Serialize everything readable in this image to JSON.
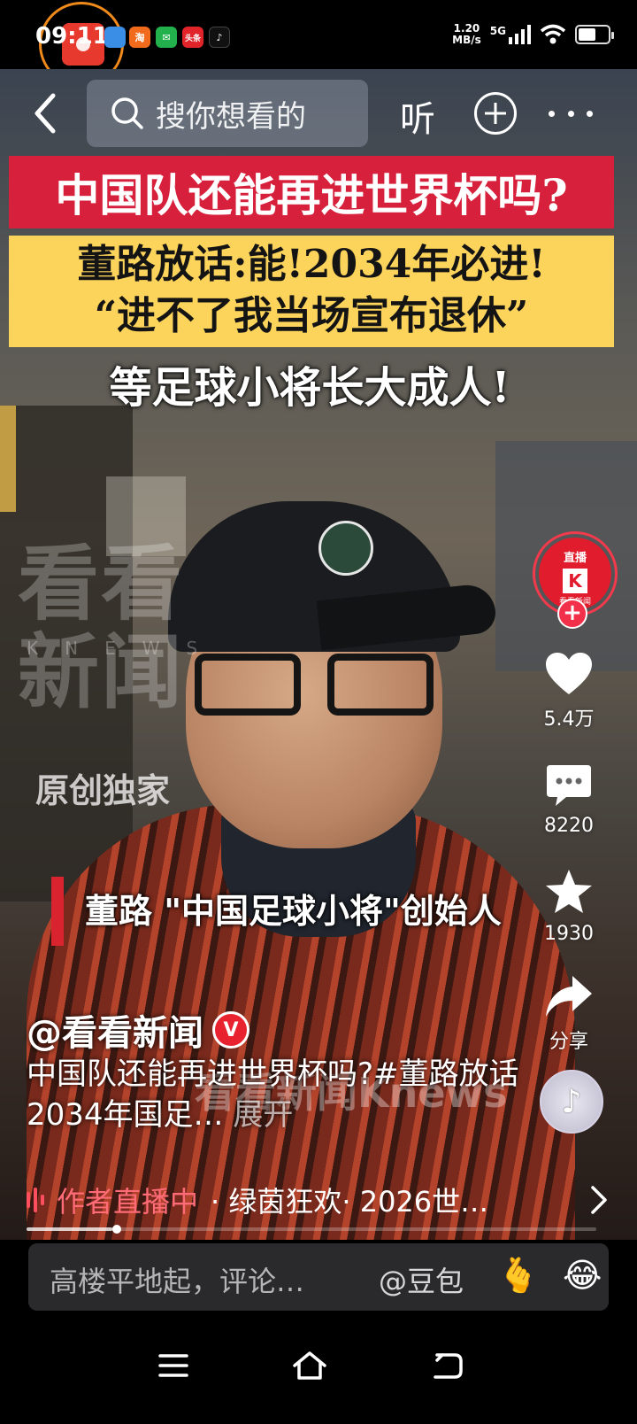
{
  "status_bar": {
    "time": "09:11",
    "net_speed_value": "1.20",
    "net_speed_unit": "MB/s",
    "network_type": "5G",
    "battery_level": 0.6
  },
  "top_nav": {
    "search_placeholder": "搜你想看的",
    "listen_label": "听"
  },
  "video": {
    "headline_red": "中国队还能再进世界杯吗?",
    "headline_yellow_line1": "董路放话:能!2034年必进!",
    "headline_yellow_line2": "“进不了我当场宣布退休”",
    "headline_white": "等足球小将长大成人!",
    "watermark_logo": "看看新闻",
    "watermark_knews": "KNEWS",
    "watermark_original": "原创独家",
    "watermark_center": "看看新闻Knews",
    "caption": "董路 \"中国足球小将\"创始人"
  },
  "side_actions": {
    "live_tag": "直播",
    "live_account": "看看新闻",
    "likes": "5.4万",
    "comments": "8220",
    "favorites": "1930",
    "share_label": "分享"
  },
  "author": {
    "name": "@看看新闻",
    "verified_badge": "V"
  },
  "description": {
    "text": "中国队还能再进世界杯吗?#董路放话2034年国足…",
    "expand": "展开"
  },
  "live_strip": {
    "label": "作者直播中",
    "info": "· 绿茵狂欢· 2026世…"
  },
  "comment_bar": {
    "placeholder": "高楼平地起，评论…",
    "mention": "@豆包",
    "emoji_1": "🫰",
    "emoji_2": "😂"
  },
  "playback": {
    "progress": 0.15
  },
  "colors": {
    "accent_red": "#d7203b",
    "banner_yellow": "#fcd35b",
    "live_pink": "#ff6b76"
  }
}
